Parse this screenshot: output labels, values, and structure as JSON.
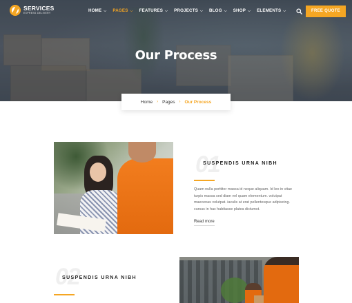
{
  "brand": {
    "name": "SERVICES",
    "tagline": "EXPRESS DELIVERY"
  },
  "nav": {
    "items": [
      {
        "label": "HOME",
        "active": false
      },
      {
        "label": "PAGES",
        "active": true
      },
      {
        "label": "FEATURES",
        "active": false
      },
      {
        "label": "PROJECTS",
        "active": false
      },
      {
        "label": "BLOG",
        "active": false
      },
      {
        "label": "SHOP",
        "active": false
      },
      {
        "label": "ELEMENTS",
        "active": false
      }
    ],
    "search_icon": "search-icon",
    "cta_label": "FREE QUOTE"
  },
  "hero": {
    "title": "Our Process"
  },
  "breadcrumb": {
    "items": [
      "Home",
      "Pages"
    ],
    "current": "Our Process"
  },
  "steps": [
    {
      "number": "01",
      "title": "SUSPENDIS URNA NIBH",
      "text": "Quam nulla porttitor massa id neque aliquam. Id leo in vitae turpis massa sed diam vel quam elementum. volutpat maecenas volutpat. iaculis at erat pellentesque adipiscing. cursus in hac habitasse platea dictumst.",
      "link": "Read more"
    },
    {
      "number": "02",
      "title": "SUSPENDIS URNA NIBH"
    }
  ],
  "colors": {
    "accent": "#f5a623",
    "hero_overlay": "#4b5560"
  }
}
